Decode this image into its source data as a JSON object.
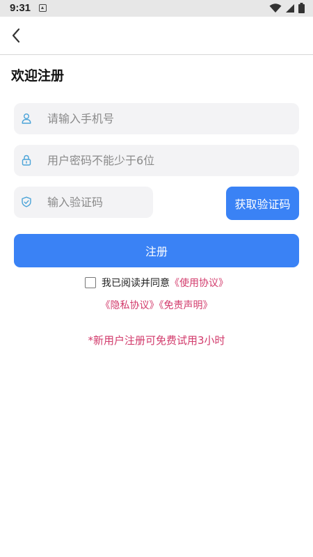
{
  "status_bar": {
    "time": "9:31",
    "icons": [
      "notification-icon",
      "wifi-icon",
      "signal-icon",
      "battery-icon"
    ]
  },
  "header": {
    "back_icon": "chevron-left-icon",
    "title": "欢迎注册"
  },
  "form": {
    "phone": {
      "placeholder": "请输入手机号",
      "value": "",
      "icon": "user-icon"
    },
    "password": {
      "placeholder": "用户密码不能少于6位",
      "value": "",
      "icon": "lock-icon"
    },
    "code": {
      "placeholder": "输入验证码",
      "value": "",
      "icon": "shield-icon"
    },
    "get_code_label": "获取验证码",
    "register_label": "注册"
  },
  "agreement": {
    "checked": false,
    "text": "我已阅读并同意",
    "terms": "《使用协议》",
    "privacy": "《隐私协议》",
    "disclaimer": "《免责声明》"
  },
  "note": "*新用户注册可免费试用3小时",
  "colors": {
    "primary": "#3a82f5",
    "accent": "#d23a6b",
    "field_bg": "#f3f3f5",
    "icon": "#4aa3d8"
  }
}
